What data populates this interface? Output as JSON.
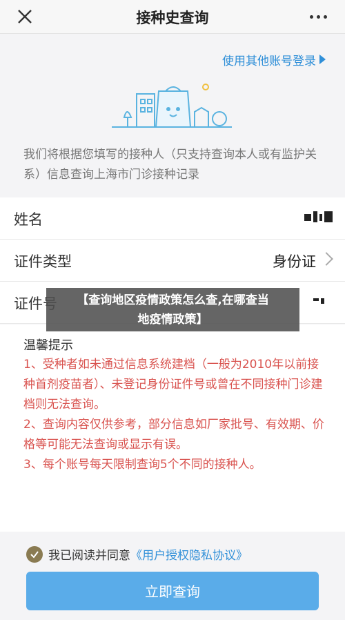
{
  "header": {
    "title": "接种史查询",
    "close_icon": "close-icon",
    "more_icon": "more-dots-icon"
  },
  "switch_account": {
    "label": "使用其他账号登录"
  },
  "intro": "我们将根据您填写的接种人（只支持查询本人或有监护关系）信息查询上海市门诊接种记录",
  "form": {
    "name_label": "姓名",
    "id_type_label": "证件类型",
    "id_type_value": "身份证",
    "id_number_label": "证件号"
  },
  "tips": {
    "title": "温馨提示",
    "items": [
      "1、受种者如未通过信息系统建档（一般为2010年以前接种首剂疫苗者）、未登记身份证件号或曾在不同接种门诊建档则无法查询。",
      "2、查询内容仅供参考，部分信息如厂家批号、有效期、价格等可能无法查询或显示有误。",
      "3、每个账号每天限制查询5个不同的接种人。"
    ]
  },
  "overlay": {
    "line1": "【查询地区疫情政策怎么查,在哪查当",
    "line2": "地疫情政策】"
  },
  "agreement": {
    "prefix": "我已阅读并同意",
    "link": "《用户授权隐私协议》",
    "checked": true
  },
  "submit": {
    "label": "立即查询"
  },
  "colors": {
    "accent": "#2f8fd8",
    "button": "#5aace9",
    "warning": "#d9534f",
    "check": "#8a7b52"
  }
}
